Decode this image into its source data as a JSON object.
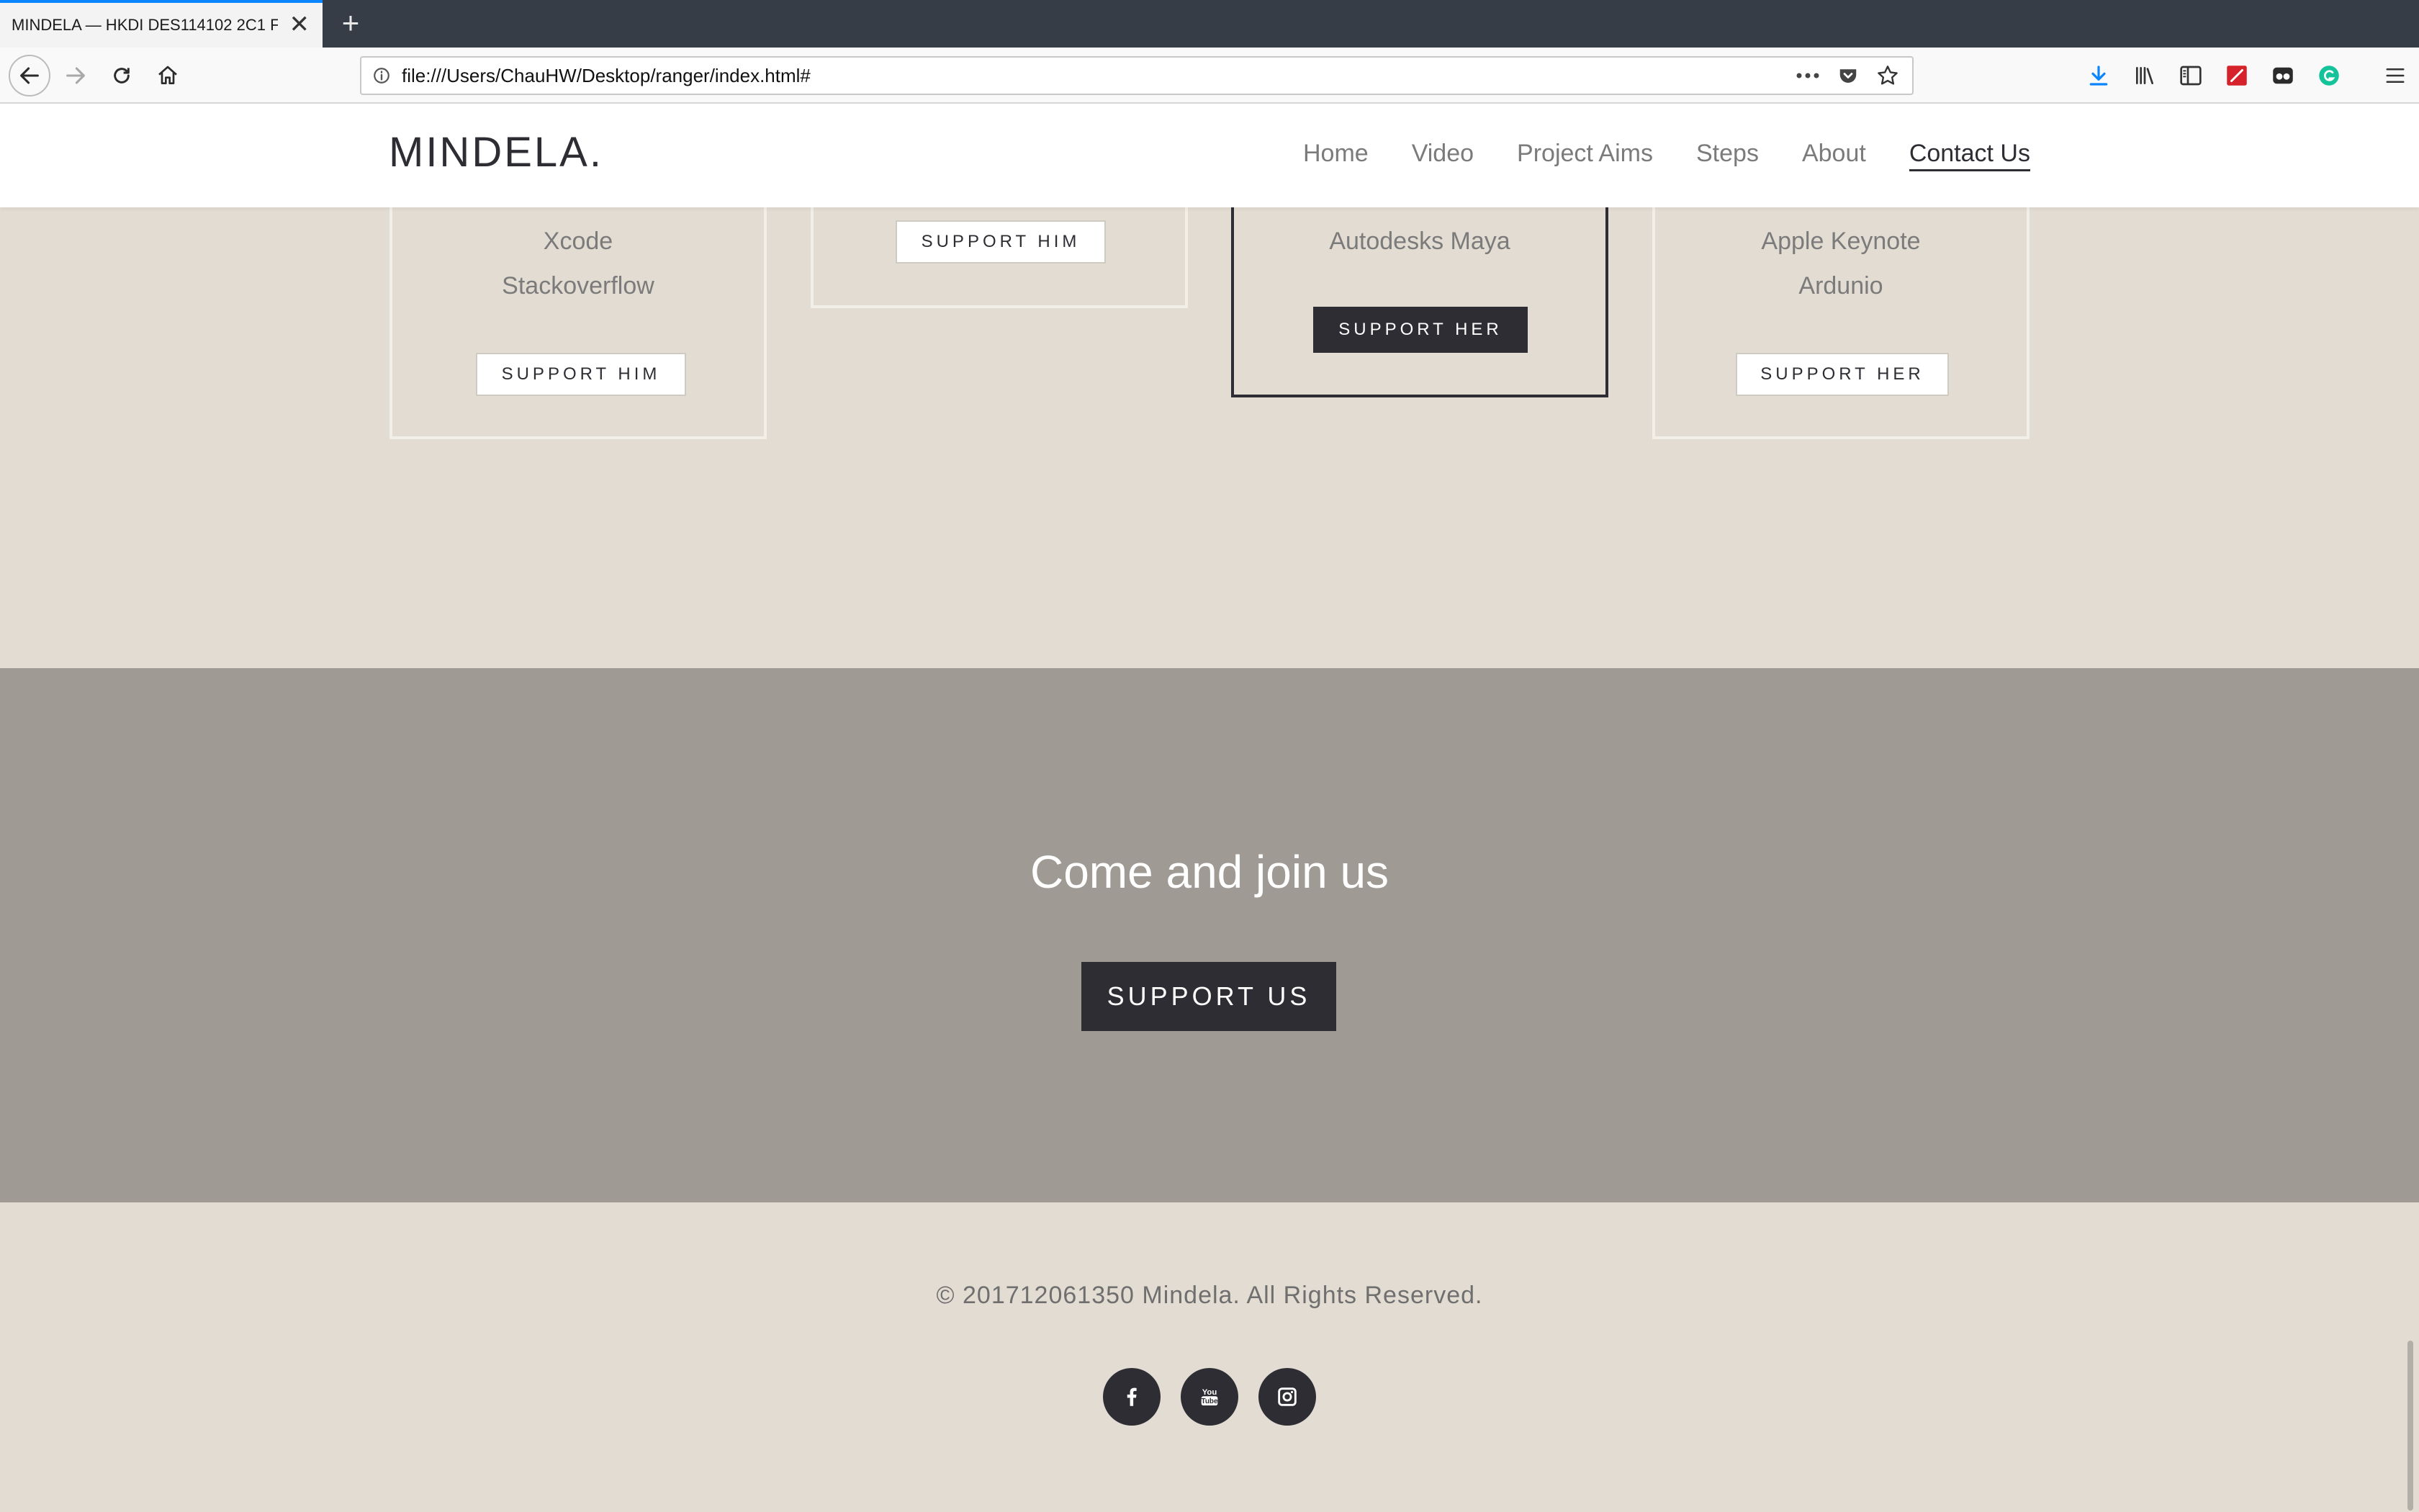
{
  "browser": {
    "tab_title": "MINDELA — HKDI DES114102 2C1 F",
    "url": "file:///Users/ChauHW/Desktop/ranger/index.html#",
    "new_tab": "+",
    "close": "✕"
  },
  "site": {
    "logo": "MINDELA.",
    "nav": [
      "Home",
      "Video",
      "Project Aims",
      "Steps",
      "About",
      "Contact Us"
    ],
    "active_nav": "Contact Us"
  },
  "cards": [
    {
      "lines": [
        "Xcode",
        "Stackoverflow"
      ],
      "button": "SUPPORT HIM"
    },
    {
      "lines": [],
      "button": "SUPPORT HIM"
    },
    {
      "lines": [
        "Autodesks Maya"
      ],
      "button": "SUPPORT HER"
    },
    {
      "lines": [
        "Apple Keynote",
        "Ardunio"
      ],
      "button": "SUPPORT HER"
    }
  ],
  "join": {
    "title": "Come and join us",
    "button": "SUPPORT US"
  },
  "footer": {
    "copyright": "© 201712061350 Mindela. All Rights Reserved.",
    "social": [
      "facebook-icon",
      "youtube-icon",
      "instagram-icon"
    ]
  },
  "colors": {
    "page_bg": "#e3dcd2",
    "join_bg": "#9f9a93",
    "dark": "#2e2d33"
  }
}
